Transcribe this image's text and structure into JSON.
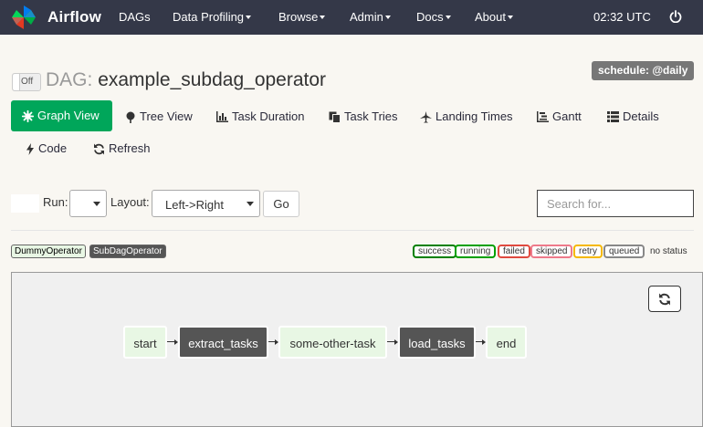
{
  "navbar": {
    "brand": "Airflow",
    "items": [
      {
        "label": "DAGs",
        "dropdown": false
      },
      {
        "label": "Data Profiling",
        "dropdown": true
      },
      {
        "label": "Browse",
        "dropdown": true
      },
      {
        "label": "Admin",
        "dropdown": true
      },
      {
        "label": "Docs",
        "dropdown": true
      },
      {
        "label": "About",
        "dropdown": true
      }
    ],
    "clock": "02:32 UTC",
    "logout_icon": "power-icon"
  },
  "header": {
    "toggle_label": "Off",
    "dag_prefix": "DAG:",
    "dag_id": "example_subdag_operator",
    "schedule": "schedule: @daily"
  },
  "tabs": [
    {
      "label": "Graph View",
      "icon": "asterisk-icon",
      "active": true
    },
    {
      "label": "Tree View",
      "icon": "tree-icon"
    },
    {
      "label": "Task Duration",
      "icon": "bar-chart-icon"
    },
    {
      "label": "Task Tries",
      "icon": "duplicate-icon"
    },
    {
      "label": "Landing Times",
      "icon": "plane-icon"
    },
    {
      "label": "Gantt",
      "icon": "gantt-icon"
    },
    {
      "label": "Details",
      "icon": "list-icon"
    },
    {
      "label": "Code",
      "icon": "flash-icon"
    },
    {
      "label": "Refresh",
      "icon": "refresh-icon"
    }
  ],
  "controls": {
    "run_label": "Run:",
    "run_value": "",
    "layout_label": "Layout:",
    "layout_value": "Left->Right",
    "go_label": "Go",
    "search_placeholder": "Search for..."
  },
  "operator_legend": [
    {
      "label": "DummyOperator",
      "bg": "#e8f7e4",
      "color": "#000000"
    },
    {
      "label": "SubDagOperator",
      "bg": "#555555",
      "color": "#ffffff"
    }
  ],
  "state_legend": [
    {
      "label": "success",
      "color": "#008000"
    },
    {
      "label": "running",
      "color": "#00a000"
    },
    {
      "label": "failed",
      "color": "#e04a3f"
    },
    {
      "label": "skipped",
      "color": "#ee7a8a"
    },
    {
      "label": "retry",
      "color": "#f5b800"
    },
    {
      "label": "queued",
      "color": "#888888"
    }
  ],
  "no_status_label": "no status",
  "graph": {
    "nodes": [
      {
        "label": "start",
        "operator": "DummyOperator"
      },
      {
        "label": "extract_tasks",
        "operator": "SubDagOperator"
      },
      {
        "label": "some-other-task",
        "operator": "DummyOperator"
      },
      {
        "label": "load_tasks",
        "operator": "SubDagOperator"
      },
      {
        "label": "end",
        "operator": "DummyOperator"
      }
    ]
  }
}
